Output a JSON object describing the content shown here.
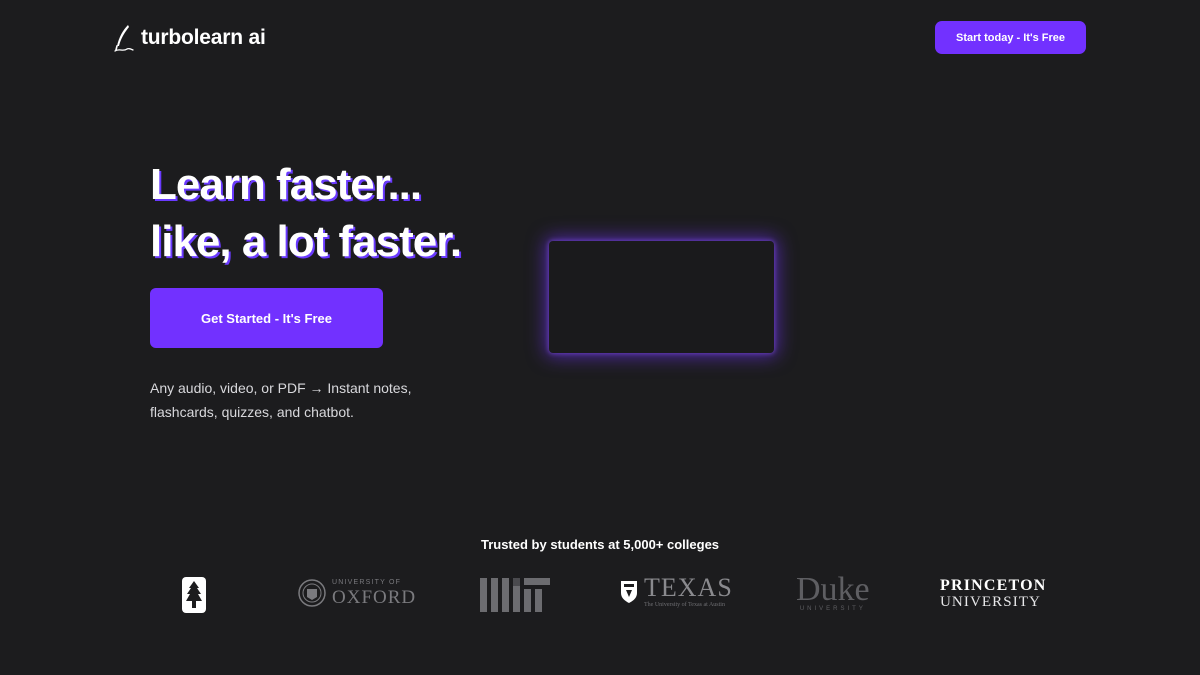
{
  "header": {
    "brand": "turbolearn ai",
    "logo_icon": "quill-icon",
    "cta_label": "Start today - It's Free"
  },
  "hero": {
    "title_line1": "Learn faster...",
    "title_line2": "like, a lot faster.",
    "cta_label": "Get Started - It's Free",
    "subtitle_line1": "Any audio, video, or PDF → Instant notes,",
    "subtitle_line2": "flashcards, quizzes, and chatbot."
  },
  "trusted": {
    "heading": "Trusted by students at 5,000+ colleges",
    "colleges": [
      {
        "name": "stanford",
        "icon": "stanford-tree-icon"
      },
      {
        "name": "oxford",
        "small": "UNIVERSITY OF",
        "big": "OXFORD",
        "icon": "oxford-crest-icon"
      },
      {
        "name": "mit",
        "icon": "mit-logo-icon"
      },
      {
        "name": "texas",
        "big": "TEXAS",
        "small": "The University of Texas at Austin",
        "icon": "texas-shield-icon"
      },
      {
        "name": "duke",
        "big": "Duke",
        "small": "UNIVERSITY"
      },
      {
        "name": "princeton",
        "line1": "PRINCETON",
        "line2": "UNIVERSITY"
      }
    ]
  },
  "colors": {
    "background": "#1c1c1e",
    "accent": "#7231ff",
    "text": "#ffffff"
  }
}
